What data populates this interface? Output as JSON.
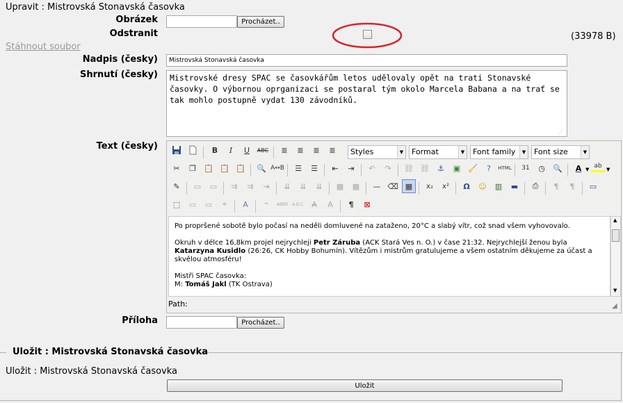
{
  "page": {
    "edit_heading": "Upravit : Mistrovská Stonavská časovka",
    "download_link": "Stáhnout soubor",
    "file_size": "(33978 B)"
  },
  "form": {
    "image_label": "Obrázek",
    "remove_label": "Odstranit",
    "title_label": "Nadpis (česky)",
    "title_value": "Mistrovská Stonavská časovka",
    "summary_label": "Shrnutí (česky)",
    "summary_value": "Mistrovské dresy SPAC se časovkářům letos udělovaly opět na trati Stonavské časovky. O výbornou oprganizaci se postaral tým okolo Marcela Babana a na trať se tak mohlo postupně vydat 130 závodníků.",
    "text_label": "Text (česky)",
    "attachment_label": "Příloha",
    "browse_label": "Procházet..",
    "remove_checked": false
  },
  "editor": {
    "styles_dropdown": "Styles",
    "format_dropdown": "Format",
    "font_family_dropdown": "Font family",
    "font_size_dropdown": "Font size",
    "path_label": "Path:",
    "para1": "Po propršené sobotě bylo počasí na neděli domluvené na zataženo, 20°C a slabý vítr, což snad všem vyhovovalo.",
    "para2_a": "Okruh v délce 16,8km projel nejrychleji ",
    "para2_b": "Petr Záruba",
    "para2_c": " (ACK Stará Ves n. O.) v čase 21:32. Nejrychlejší ženou byla ",
    "para2_d": "Katarzyna Kusidlo",
    "para2_e": " (26:26, CK Hobby Bohumín). Vítězům i mistrům gratulujeme a všem ostatním děkujeme za účast a skvělou atmosféru!",
    "para3_a": "Mistři SPAC časovka:",
    "para3_b": "M: ",
    "para3_c": "Tomáš Jakl",
    "para3_d": " (TK Ostrava)"
  },
  "save": {
    "legend": "Uložit : Mistrovská Stonavská časovka",
    "heading": "Uložit : Mistrovská Stonavská časovka",
    "button": "Uložit"
  },
  "colors": {
    "annotation_circle": "#d9232a",
    "background": "#f0f0f0"
  }
}
